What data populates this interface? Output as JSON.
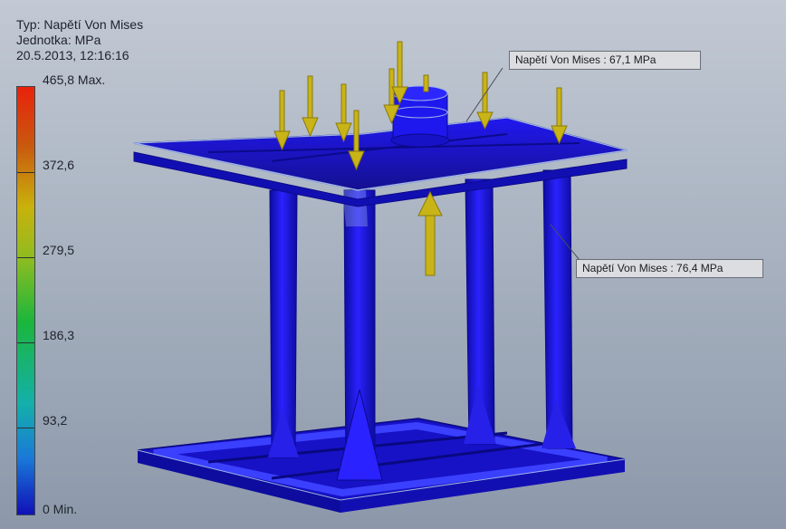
{
  "header": {
    "type_line": "Typ: Napětí Von Mises",
    "unit_line": "Jednotka: MPa",
    "date_line": "20.5.2013, 12:16:16"
  },
  "legend": {
    "max_label": "465,8 Max.",
    "ticks": [
      "372,6",
      "279,5",
      "186,3",
      "93,2"
    ],
    "min_label": "0 Min."
  },
  "callouts": {
    "upper": "Napětí Von Mises : 67,1 MPa",
    "lower": "Napětí Von Mises : 76,4 MPa"
  },
  "colors": {
    "structure": "#1a14e6",
    "structure_dark": "#0b0a8a",
    "edge": "#9fb4e6",
    "arrow": "#c9b418"
  }
}
